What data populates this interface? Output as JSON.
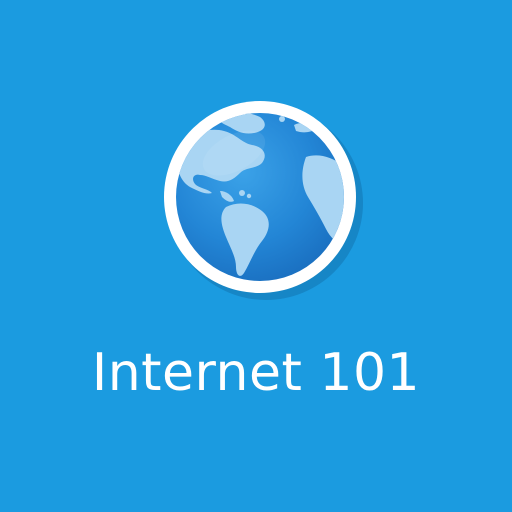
{
  "app": {
    "title": "Internet 101",
    "icon": "globe-icon"
  },
  "colors": {
    "background": "#1b9be0",
    "globe_ring": "#ffffff",
    "ocean": "#2386d6",
    "land": "#a9d5f3",
    "text": "#ffffff"
  }
}
